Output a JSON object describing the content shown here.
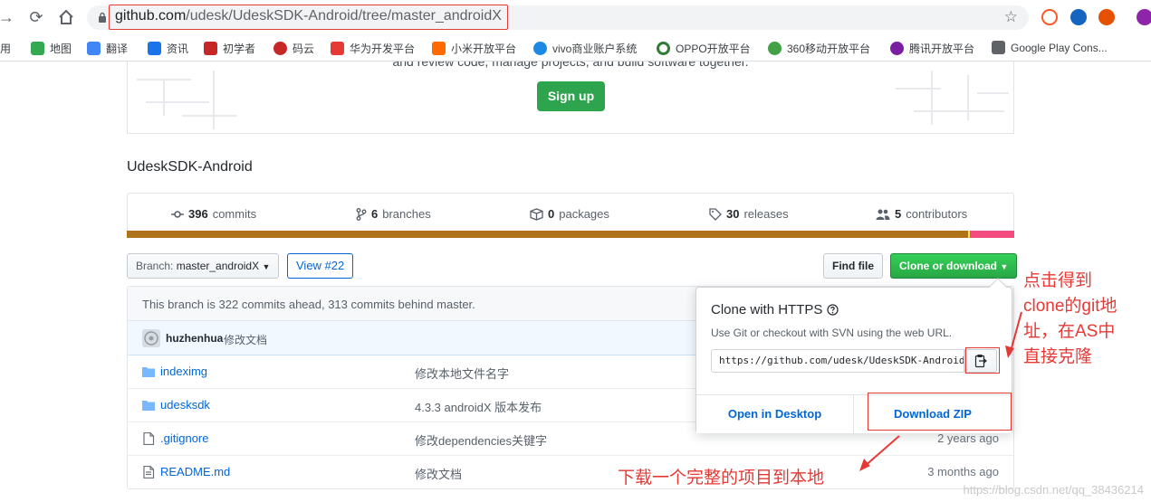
{
  "browser": {
    "url_host": "github.com",
    "url_path": "/udesk/UdeskSDK-Android/tree/master_androidX"
  },
  "bookmarks": [
    {
      "label": "应用",
      "color": "#4285f4"
    },
    {
      "label": "地图",
      "color": "#34a853"
    },
    {
      "label": "翻译",
      "color": "#4285f4"
    },
    {
      "label": "资讯",
      "color": "#1a73e8"
    },
    {
      "label": "初学者",
      "color": "#c62828"
    },
    {
      "label": "码云",
      "color": "#c62828"
    },
    {
      "label": "华为开发平台",
      "color": "#e53935"
    },
    {
      "label": "小米开放平台",
      "color": "#ff6900"
    },
    {
      "label": "vivo商业账户系统",
      "color": "#1e88e5"
    },
    {
      "label": "OPPO开放平台",
      "color": "#2e7d32"
    },
    {
      "label": "360移动开放平台",
      "color": "#43a047"
    },
    {
      "label": "腾讯开放平台",
      "color": "#7b1fa2"
    },
    {
      "label": "Google Play Cons...",
      "color": "#5f6368"
    }
  ],
  "hero": {
    "text": "and review code, manage projects, and build software together.",
    "signup_label": "Sign up"
  },
  "repo": {
    "name": "UdeskSDK-Android"
  },
  "stats": {
    "commits_count": "396",
    "commits_label": "commits",
    "branches_count": "6",
    "branches_label": "branches",
    "packages_count": "0",
    "packages_label": "packages",
    "releases_count": "30",
    "releases_label": "releases",
    "contributors_count": "5",
    "contributors_label": "contributors"
  },
  "language_bar": [
    {
      "color": "#b07219",
      "fraction": 0.948
    },
    {
      "color": "#f1e05a",
      "fraction": 0.002
    },
    {
      "color": "#f34b7d",
      "fraction": 0.05
    }
  ],
  "controls": {
    "branch_label": "Branch:",
    "branch_value": "master_androidX",
    "view_pr": "View #22",
    "find_file": "Find file",
    "clone_download": "Clone or download"
  },
  "branch_status": "This branch is 322 commits ahead, 313 commits behind master.",
  "latest_commit": {
    "author": "huzhenhua",
    "message": "修改文档"
  },
  "files": [
    {
      "type": "dir",
      "name": "indeximg",
      "message": "修改本地文件名字",
      "age": ""
    },
    {
      "type": "dir",
      "name": "udesksdk",
      "message": "4.3.3 androidX 版本发布",
      "age": ""
    },
    {
      "type": "file",
      "name": ".gitignore",
      "message": "修改dependencies关键字",
      "age": "2 years ago"
    },
    {
      "type": "file",
      "name": "README.md",
      "message": "修改文档",
      "age": "3 months ago"
    }
  ],
  "clone_popover": {
    "title": "Clone with HTTPS",
    "description": "Use Git or checkout with SVN using the web URL.",
    "url": "https://github.com/udesk/UdeskSDK-Android.git",
    "open_desktop": "Open in Desktop",
    "download_zip": "Download ZIP"
  },
  "annotations": {
    "clone_note_1": "点击得到",
    "clone_note_2": "clone的git地",
    "clone_note_3": "址，在AS中",
    "clone_note_4": "直接克隆",
    "zip_note": "下载一个完整的项目到本地",
    "color": "#e53935"
  },
  "watermark": "https://blog.csdn.net/qq_38436214"
}
